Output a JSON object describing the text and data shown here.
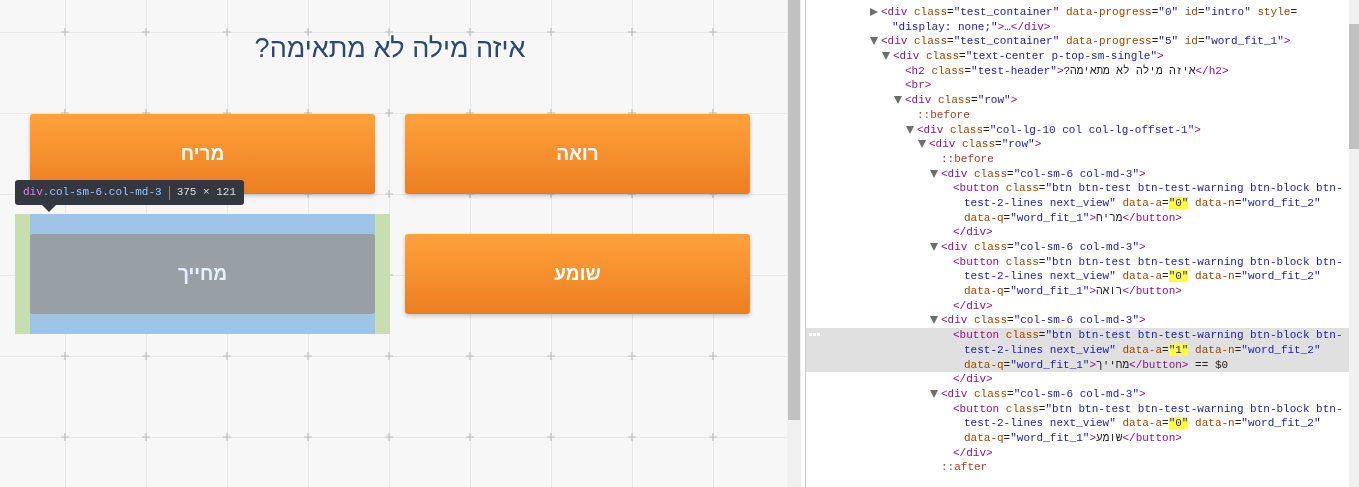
{
  "page": {
    "heading": "?איזה מילה לא מתאימה",
    "answers": [
      {
        "label": "מריח",
        "inspected": false
      },
      {
        "label": "רואה",
        "inspected": false
      },
      {
        "label": "מחייך",
        "inspected": true
      },
      {
        "label": "שומע",
        "inspected": false
      }
    ]
  },
  "inspector_tooltip": {
    "selector": "div.col-sm-6.col-md-3",
    "size": "375 × 121"
  },
  "elements_tree": [
    {
      "kind": "tag",
      "expanded": false,
      "lines": [
        "<div class=\"test_container\" data-progress=\"0\" id=\"intro\" style=",
        "\"display: none;\">…</div>"
      ]
    },
    {
      "kind": "tag",
      "expanded": true,
      "lines": [
        "<div class=\"test_container\" data-progress=\"5\" id=\"word_fit_1\">"
      ],
      "children": [
        {
          "kind": "tag",
          "expanded": true,
          "lines": [
            "<div class=\"text-center p-top-sm-single\">"
          ],
          "children": [
            {
              "kind": "tag",
              "lines": [
                "<h2 class=\"test-header\">?איזה מילה לא מתאימה</h2>"
              ]
            },
            {
              "kind": "tag",
              "lines": [
                "<br>"
              ]
            },
            {
              "kind": "tag",
              "expanded": true,
              "lines": [
                "<div class=\"row\">"
              ],
              "children": [
                {
                  "kind": "pseudo",
                  "lines": [
                    "::before"
                  ]
                },
                {
                  "kind": "tag",
                  "expanded": true,
                  "lines": [
                    "<div class=\"col-lg-10 col col-lg-offset-1\">"
                  ],
                  "children": [
                    {
                      "kind": "tag",
                      "expanded": true,
                      "lines": [
                        "<div class=\"row\">"
                      ],
                      "children": [
                        {
                          "kind": "pseudo",
                          "lines": [
                            "::before"
                          ]
                        },
                        {
                          "kind": "tag",
                          "expanded": true,
                          "lines": [
                            "<div class=\"col-sm-6 col-md-3\">"
                          ],
                          "children": [
                            {
                              "kind": "tag",
                              "selected": false,
                              "lines": [
                                "<button class=\"btn btn-test btn-test-warning btn-block btn-",
                                [
                                  {
                                    "text": "test-2-lines next_view\" data-a="
                                  },
                                  {
                                    "text": "\"0\"",
                                    "highlighted": true
                                  },
                                  {
                                    "text": " data-n=\"word_fit_2\""
                                  }
                                ],
                                "data-q=\"word_fit_1\">מריח</button>"
                              ]
                            },
                            {
                              "kind": "tag",
                              "lines": [
                                "</div>"
                              ]
                            }
                          ]
                        },
                        {
                          "kind": "tag",
                          "expanded": true,
                          "lines": [
                            "<div class=\"col-sm-6 col-md-3\">"
                          ],
                          "children": [
                            {
                              "kind": "tag",
                              "selected": false,
                              "lines": [
                                "<button class=\"btn btn-test btn-test-warning btn-block btn-",
                                [
                                  {
                                    "text": "test-2-lines next_view\" data-a="
                                  },
                                  {
                                    "text": "\"0\"",
                                    "highlighted": true
                                  },
                                  {
                                    "text": " data-n=\"word_fit_2\""
                                  }
                                ],
                                "data-q=\"word_fit_1\">רואה</button>"
                              ]
                            },
                            {
                              "kind": "tag",
                              "lines": [
                                "</div>"
                              ]
                            }
                          ]
                        },
                        {
                          "kind": "tag",
                          "expanded": true,
                          "lines": [
                            "<div class=\"col-sm-6 col-md-3\">"
                          ],
                          "children": [
                            {
                              "kind": "tag",
                              "selected": true,
                              "lines": [
                                "<button class=\"btn btn-test btn-test-warning btn-block btn-",
                                [
                                  {
                                    "text": "test-2-lines next_view\" data-a="
                                  },
                                  {
                                    "text": "\"1\"",
                                    "highlighted": true
                                  },
                                  {
                                    "text": " data-n=\"word_fit_2\""
                                  }
                                ],
                                "data-q=\"word_fit_1\">מחייך</button> == $0"
                              ]
                            },
                            {
                              "kind": "tag",
                              "lines": [
                                "</div>"
                              ]
                            }
                          ]
                        },
                        {
                          "kind": "tag",
                          "expanded": true,
                          "lines": [
                            "<div class=\"col-sm-6 col-md-3\">"
                          ],
                          "children": [
                            {
                              "kind": "tag",
                              "selected": false,
                              "lines": [
                                "<button class=\"btn btn-test btn-test-warning btn-block btn-",
                                [
                                  {
                                    "text": "test-2-lines next_view\" data-a="
                                  },
                                  {
                                    "text": "\"0\"",
                                    "highlighted": true
                                  },
                                  {
                                    "text": " data-n=\"word_fit_2\""
                                  }
                                ],
                                "data-q=\"word_fit_1\">שומע</button>"
                              ]
                            },
                            {
                              "kind": "tag",
                              "lines": [
                                "</div>"
                              ]
                            }
                          ]
                        },
                        {
                          "kind": "pseudo",
                          "lines": [
                            "::after"
                          ]
                        }
                      ]
                    }
                  ]
                }
              ]
            }
          ]
        }
      ]
    }
  ]
}
